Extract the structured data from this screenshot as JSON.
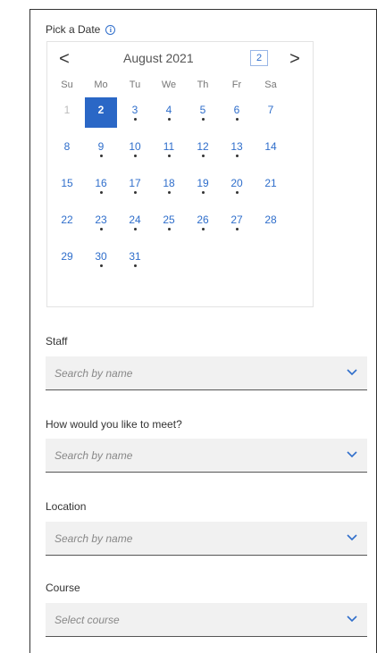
{
  "pick_date": {
    "label": "Pick a Date",
    "info_icon": "info-icon"
  },
  "calendar": {
    "month_title": "August 2021",
    "selected_day": "2",
    "prev_label": "<",
    "next_label": ">",
    "weekdays": [
      "Su",
      "Mo",
      "Tu",
      "We",
      "Th",
      "Fr",
      "Sa"
    ],
    "weeks": [
      [
        {
          "d": "1",
          "muted": true
        },
        {
          "d": "2",
          "selected": true
        },
        {
          "d": "3",
          "dot": true
        },
        {
          "d": "4",
          "dot": true
        },
        {
          "d": "5",
          "dot": true
        },
        {
          "d": "6",
          "dot": true
        },
        {
          "d": "7"
        }
      ],
      [
        {
          "d": "8"
        },
        {
          "d": "9",
          "dot": true
        },
        {
          "d": "10",
          "dot": true
        },
        {
          "d": "11",
          "dot": true
        },
        {
          "d": "12",
          "dot": true
        },
        {
          "d": "13",
          "dot": true
        },
        {
          "d": "14"
        }
      ],
      [
        {
          "d": "15"
        },
        {
          "d": "16",
          "dot": true
        },
        {
          "d": "17",
          "dot": true
        },
        {
          "d": "18",
          "dot": true
        },
        {
          "d": "19",
          "dot": true
        },
        {
          "d": "20",
          "dot": true
        },
        {
          "d": "21"
        }
      ],
      [
        {
          "d": "22"
        },
        {
          "d": "23",
          "dot": true
        },
        {
          "d": "24",
          "dot": true
        },
        {
          "d": "25",
          "dot": true
        },
        {
          "d": "26",
          "dot": true
        },
        {
          "d": "27",
          "dot": true
        },
        {
          "d": "28"
        }
      ],
      [
        {
          "d": "29"
        },
        {
          "d": "30",
          "dot": true
        },
        {
          "d": "31",
          "dot": true
        }
      ]
    ],
    "accent_color": "#2a67c6"
  },
  "fields": {
    "staff": {
      "label": "Staff",
      "placeholder": "Search by name"
    },
    "meet": {
      "label": "How would you like to meet?",
      "placeholder": "Search by name"
    },
    "location": {
      "label": "Location",
      "placeholder": "Search by name"
    },
    "course": {
      "label": "Course",
      "placeholder": "Select course"
    }
  }
}
